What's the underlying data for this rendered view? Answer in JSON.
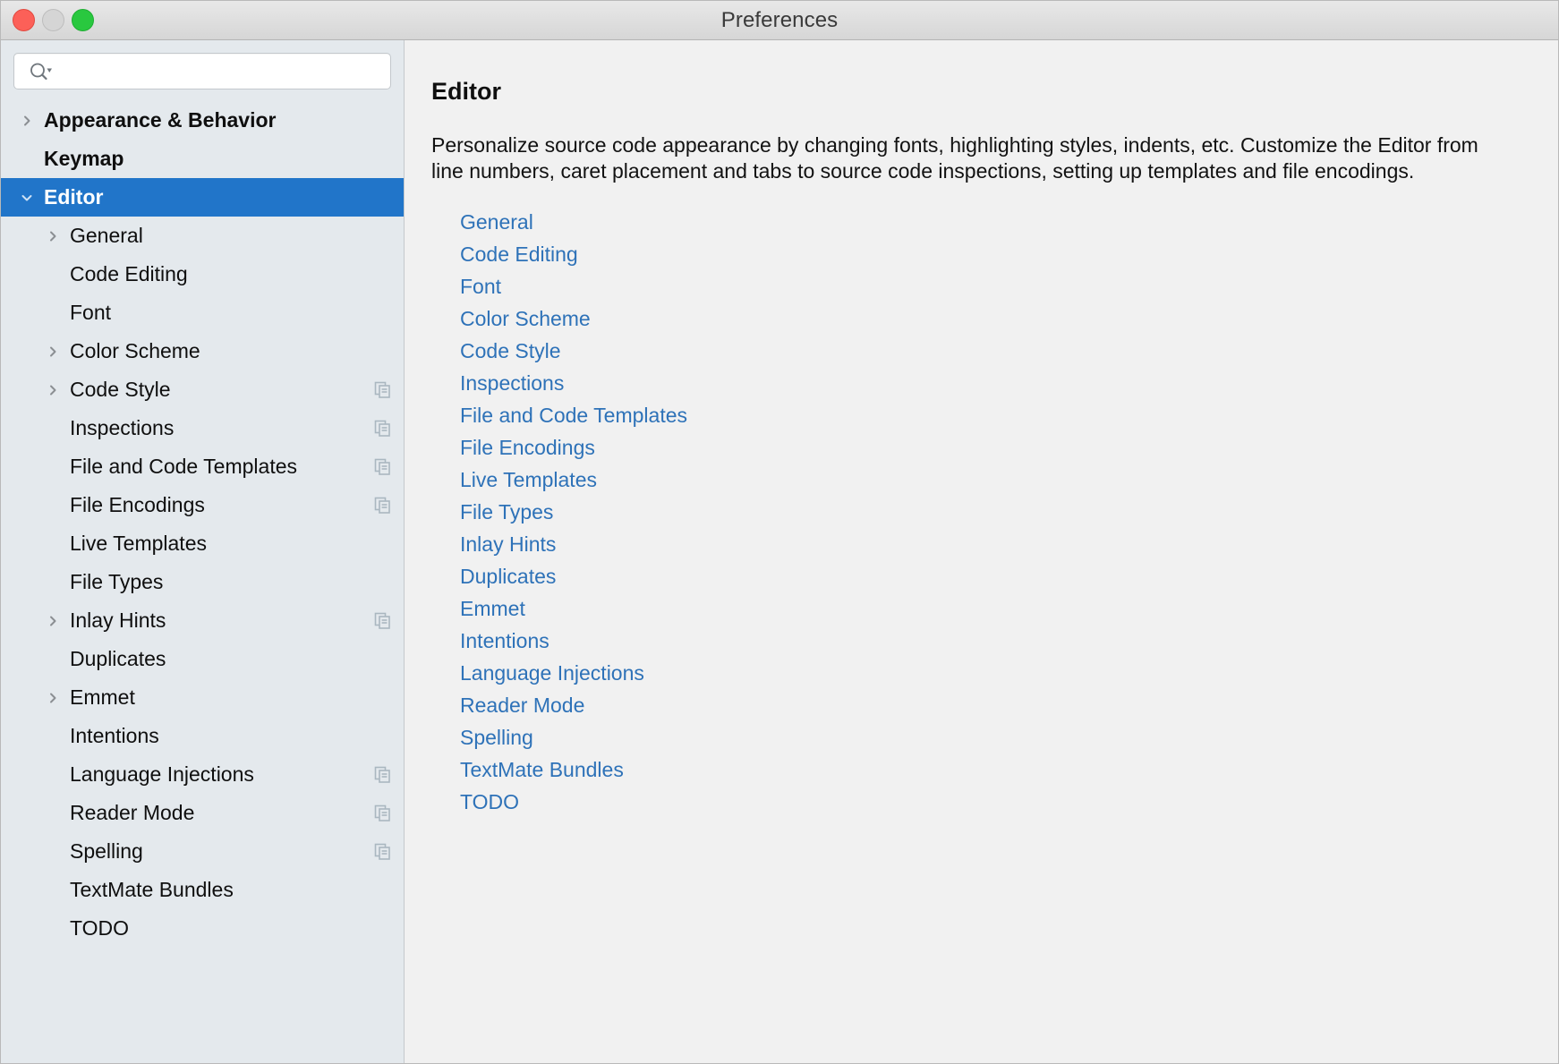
{
  "window": {
    "title": "Preferences",
    "traffic_lights": [
      "close",
      "minimize",
      "maximize"
    ]
  },
  "colors": {
    "selection_blue": "#2175c9",
    "link_blue": "#2e72b8",
    "sidebar_bg": "#e4e9ed",
    "main_bg": "#f1f1f1",
    "titlebar_bg": "#dcdcdc",
    "close_red": "#fc6058",
    "minimize_gray": "#d5d5d5",
    "maximize_green": "#29c83f",
    "copy_icon_gray": "#aab7c0"
  },
  "search": {
    "value": "",
    "placeholder": "",
    "icon": "search-icon-with-dropdown-arrow"
  },
  "sidebar": {
    "items": [
      {
        "label": "Appearance & Behavior",
        "level": 0,
        "bold": true,
        "twisty": "right",
        "selected": false,
        "copy_icon": false
      },
      {
        "label": "Keymap",
        "level": 0,
        "bold": true,
        "twisty": "none",
        "selected": false,
        "copy_icon": false
      },
      {
        "label": "Editor",
        "level": 0,
        "bold": true,
        "twisty": "down",
        "selected": true,
        "copy_icon": false
      },
      {
        "label": "General",
        "level": 1,
        "bold": false,
        "twisty": "right",
        "selected": false,
        "copy_icon": false
      },
      {
        "label": "Code Editing",
        "level": 1,
        "bold": false,
        "twisty": "none",
        "selected": false,
        "copy_icon": false
      },
      {
        "label": "Font",
        "level": 1,
        "bold": false,
        "twisty": "none",
        "selected": false,
        "copy_icon": false
      },
      {
        "label": "Color Scheme",
        "level": 1,
        "bold": false,
        "twisty": "right",
        "selected": false,
        "copy_icon": false
      },
      {
        "label": "Code Style",
        "level": 1,
        "bold": false,
        "twisty": "right",
        "selected": false,
        "copy_icon": true
      },
      {
        "label": "Inspections",
        "level": 1,
        "bold": false,
        "twisty": "none",
        "selected": false,
        "copy_icon": true
      },
      {
        "label": "File and Code Templates",
        "level": 1,
        "bold": false,
        "twisty": "none",
        "selected": false,
        "copy_icon": true
      },
      {
        "label": "File Encodings",
        "level": 1,
        "bold": false,
        "twisty": "none",
        "selected": false,
        "copy_icon": true
      },
      {
        "label": "Live Templates",
        "level": 1,
        "bold": false,
        "twisty": "none",
        "selected": false,
        "copy_icon": false
      },
      {
        "label": "File Types",
        "level": 1,
        "bold": false,
        "twisty": "none",
        "selected": false,
        "copy_icon": false
      },
      {
        "label": "Inlay Hints",
        "level": 1,
        "bold": false,
        "twisty": "right",
        "selected": false,
        "copy_icon": true
      },
      {
        "label": "Duplicates",
        "level": 1,
        "bold": false,
        "twisty": "none",
        "selected": false,
        "copy_icon": false
      },
      {
        "label": "Emmet",
        "level": 1,
        "bold": false,
        "twisty": "right",
        "selected": false,
        "copy_icon": false
      },
      {
        "label": "Intentions",
        "level": 1,
        "bold": false,
        "twisty": "none",
        "selected": false,
        "copy_icon": false
      },
      {
        "label": "Language Injections",
        "level": 1,
        "bold": false,
        "twisty": "none",
        "selected": false,
        "copy_icon": true
      },
      {
        "label": "Reader Mode",
        "level": 1,
        "bold": false,
        "twisty": "none",
        "selected": false,
        "copy_icon": true
      },
      {
        "label": "Spelling",
        "level": 1,
        "bold": false,
        "twisty": "none",
        "selected": false,
        "copy_icon": true
      },
      {
        "label": "TextMate Bundles",
        "level": 1,
        "bold": false,
        "twisty": "none",
        "selected": false,
        "copy_icon": false
      },
      {
        "label": "TODO",
        "level": 1,
        "bold": false,
        "twisty": "none",
        "selected": false,
        "copy_icon": false
      }
    ]
  },
  "main": {
    "title": "Editor",
    "description": "Personalize source code appearance by changing fonts, highlighting styles, indents, etc. Customize the Editor from line numbers, caret placement and tabs to source code inspections, setting up templates and file encodings.",
    "links": [
      "General",
      "Code Editing",
      "Font",
      "Color Scheme",
      "Code Style",
      "Inspections",
      "File and Code Templates",
      "File Encodings",
      "Live Templates",
      "File Types",
      "Inlay Hints",
      "Duplicates",
      "Emmet",
      "Intentions",
      "Language Injections",
      "Reader Mode",
      "Spelling",
      "TextMate Bundles",
      "TODO"
    ]
  }
}
